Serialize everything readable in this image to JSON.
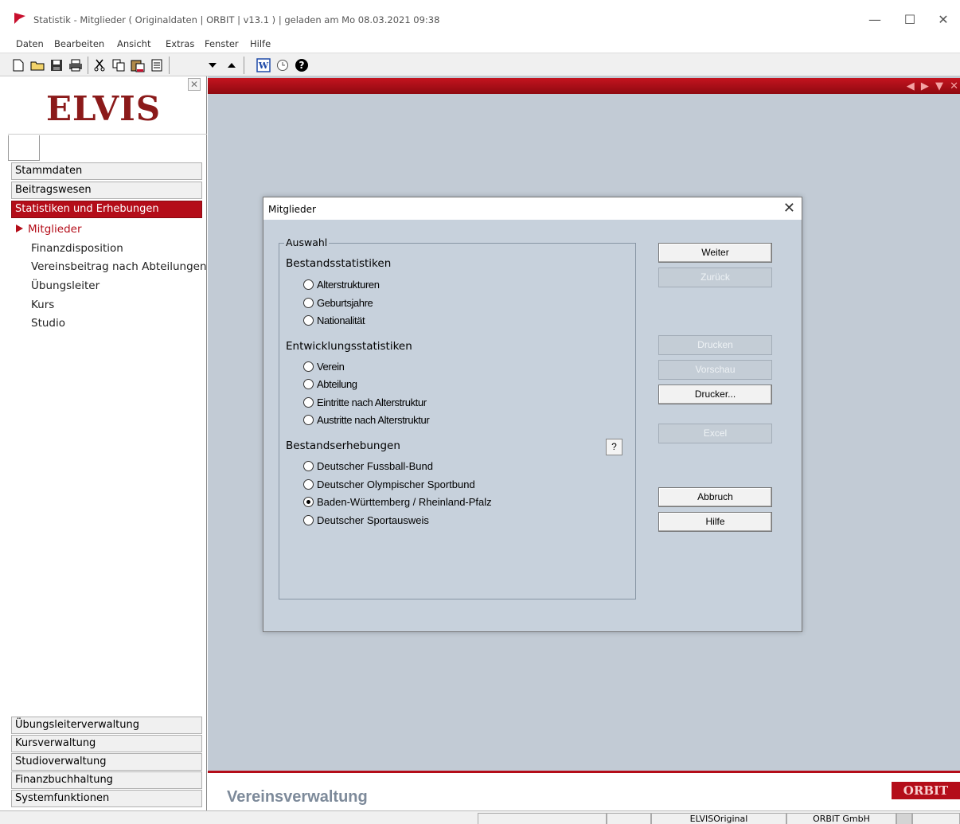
{
  "window": {
    "title": "Statistik - Mitglieder  ( Originaldaten | ORBIT | v13.1 ) | geladen am Mo 08.03.2021 09:38",
    "controls": {
      "minimize": "—",
      "maximize": "☐",
      "close": "✕"
    }
  },
  "menu": [
    "Daten",
    "Bearbeiten",
    "Ansicht",
    "Extras",
    "Fenster",
    "Hilfe"
  ],
  "toolbar": {
    "icons": [
      "new-document-icon",
      "open-folder-icon",
      "save-icon",
      "print-icon",
      "cut-icon",
      "copy-icon",
      "paste-icon",
      "notepad-icon",
      "arrow-down-icon",
      "arrow-up-icon",
      "word-icon",
      "clock-icon",
      "help-icon"
    ]
  },
  "sidebar": {
    "close": "✕",
    "logo": "ELVIS",
    "top_nav": [
      "Stammdaten",
      "Beitragswesen",
      "Statistiken und Erhebungen"
    ],
    "active_nav": "Statistiken und Erhebungen",
    "sub_items": [
      "Mitglieder",
      "Finanzdisposition",
      "Vereinsbeitrag nach Abteilungen",
      "Übungsleiter",
      "Kurs",
      "Studio"
    ],
    "current_sub": "Mitglieder",
    "bottom_nav": [
      "Übungsleiterverwaltung",
      "Kursverwaltung",
      "Studioverwaltung",
      "Finanzbuchhaltung",
      "Systemfunktionen"
    ]
  },
  "main": {
    "redbar_arrows": "◀ ▶ ▼ ✕",
    "footer_brand": "Vereinsverwaltung",
    "footer_logo": "ORBIT"
  },
  "statusbar": {
    "cells": [
      "",
      "",
      "ELVISOriginal",
      "ORBIT GmbH",
      "",
      ""
    ]
  },
  "dialog": {
    "title": "Mitglieder",
    "close": "✕",
    "group_label": "Auswahl",
    "help_button": "?",
    "sections": [
      {
        "label": "Bestandsstatistiken",
        "options": [
          "Alterstrukturen",
          "Geburtsjahre",
          "Nationalität"
        ]
      },
      {
        "label": "Entwicklungsstatistiken",
        "options": [
          "Verein",
          "Abteilung",
          "Eintritte nach Alterstruktur",
          "Austritte nach Alterstruktur"
        ]
      },
      {
        "label": "Bestandserhebungen",
        "options": [
          "Deutscher Fussball-Bund",
          "Deutscher Olympischer Sportbund",
          "Baden-Württemberg / Rheinland-Pfalz",
          "Deutscher Sportausweis"
        ]
      }
    ],
    "selected_option": "Baden-Württemberg / Rheinland-Pfalz",
    "buttons": {
      "weiter": "Weiter",
      "zurueck": "Zurück",
      "drucken": "Drucken",
      "vorschau": "Vorschau",
      "drucker": "Drucker...",
      "excel": "Excel",
      "abbruch": "Abbruch",
      "hilfe": "Hilfe"
    }
  },
  "colors": {
    "accent": "#b40d19",
    "workspace": "#c2cbd5",
    "dialog_bg": "#c7d1dc"
  }
}
